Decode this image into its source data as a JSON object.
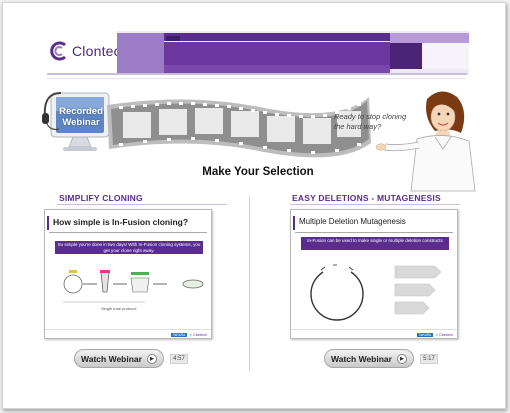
{
  "header": {
    "logo_text": "Clontech",
    "colors": {
      "brand_purple": "#5a2d8c",
      "light_purple": "#9c7cc4",
      "pale_purple": "#d9cde8"
    }
  },
  "hero": {
    "badge_line1": "Recorded",
    "badge_line2": "Webinar",
    "speech": "Ready to stop cloning the hard way?",
    "heading": "Make Your Selection"
  },
  "columns": [
    {
      "title": "SIMPLIFY CLONING",
      "thumb_title": "How simple is In-Fusion cloning?",
      "thumb_banner": "So simple you're done in two days! With In-Fusion cloning systems, you get your clone right away.",
      "thumb_caption": "Single tube protocol",
      "button_label": "Watch Webinar",
      "duration": "4:57"
    },
    {
      "title": "EASY DELETIONS - MUTAGENESIS",
      "thumb_title": "Multiple Deletion Mutagenesis",
      "thumb_banner": "In-Fusion can be used to make single or multiple deletion constructs",
      "button_label": "Watch Webinar",
      "duration": "5:17"
    }
  ]
}
